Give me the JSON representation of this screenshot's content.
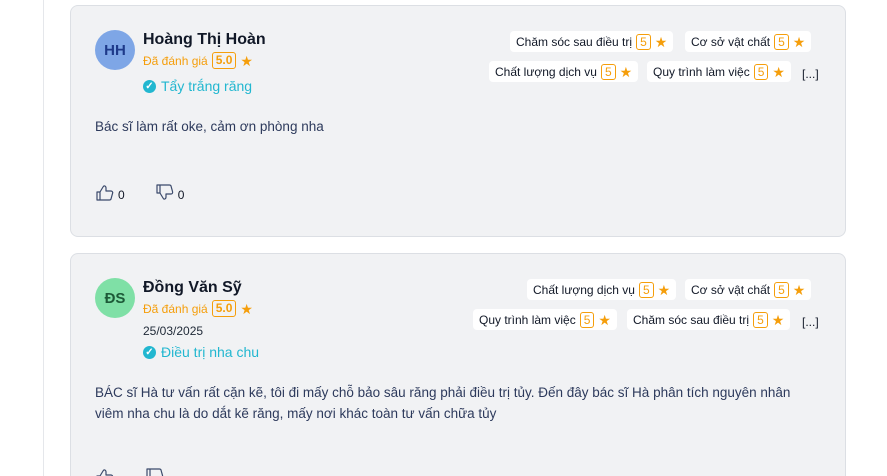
{
  "reviews": [
    {
      "initials": "HH",
      "name": "Hoàng Thị Hoàn",
      "rated_label": "Đã đánh giá",
      "score": "5.0",
      "date": "",
      "service": "Tẩy trắng răng",
      "criteria": [
        {
          "label": "Chăm sóc sau điều trị",
          "score": "5"
        },
        {
          "label": "Cơ sở vật chất",
          "score": "5"
        },
        {
          "label": "Chất lượng dịch vụ",
          "score": "5"
        },
        {
          "label": "Quy trình làm việc",
          "score": "5"
        }
      ],
      "more": "[...]",
      "comment": "Bác sĩ làm rất oke, cảm ơn phòng nha",
      "likes": "0",
      "dislikes": "0"
    },
    {
      "initials": "ĐS",
      "name": "Đồng Văn Sỹ",
      "rated_label": "Đã đánh giá",
      "score": "5.0",
      "date": "25/03/2025",
      "service": "Điều trị nha chu",
      "criteria": [
        {
          "label": "Chất lượng dịch vụ",
          "score": "5"
        },
        {
          "label": "Cơ sở vật chất",
          "score": "5"
        },
        {
          "label": "Quy trình làm việc",
          "score": "5"
        },
        {
          "label": "Chăm sóc sau điều trị",
          "score": "5"
        }
      ],
      "more": "[...]",
      "comment": "BÁC sĩ Hà tư vấn rất cặn kẽ, tôi đi mấy chỗ bảo sâu răng phải điều trị tủy. Đến đây bác sĩ Hà phân tích nguyên nhân viêm nha chu là do dắt kẽ răng, mấy nơi khác toàn tư vấn chữa tủy"
    }
  ],
  "colors": {
    "accent_star": "#f59e0b",
    "service_teal": "#22b7d0",
    "card_bg": "#f1f2f4"
  },
  "icons": {
    "like": "thumbs-up-icon",
    "dislike": "thumbs-down-icon",
    "verified": "check-circle-icon",
    "rating": "star-icon"
  }
}
